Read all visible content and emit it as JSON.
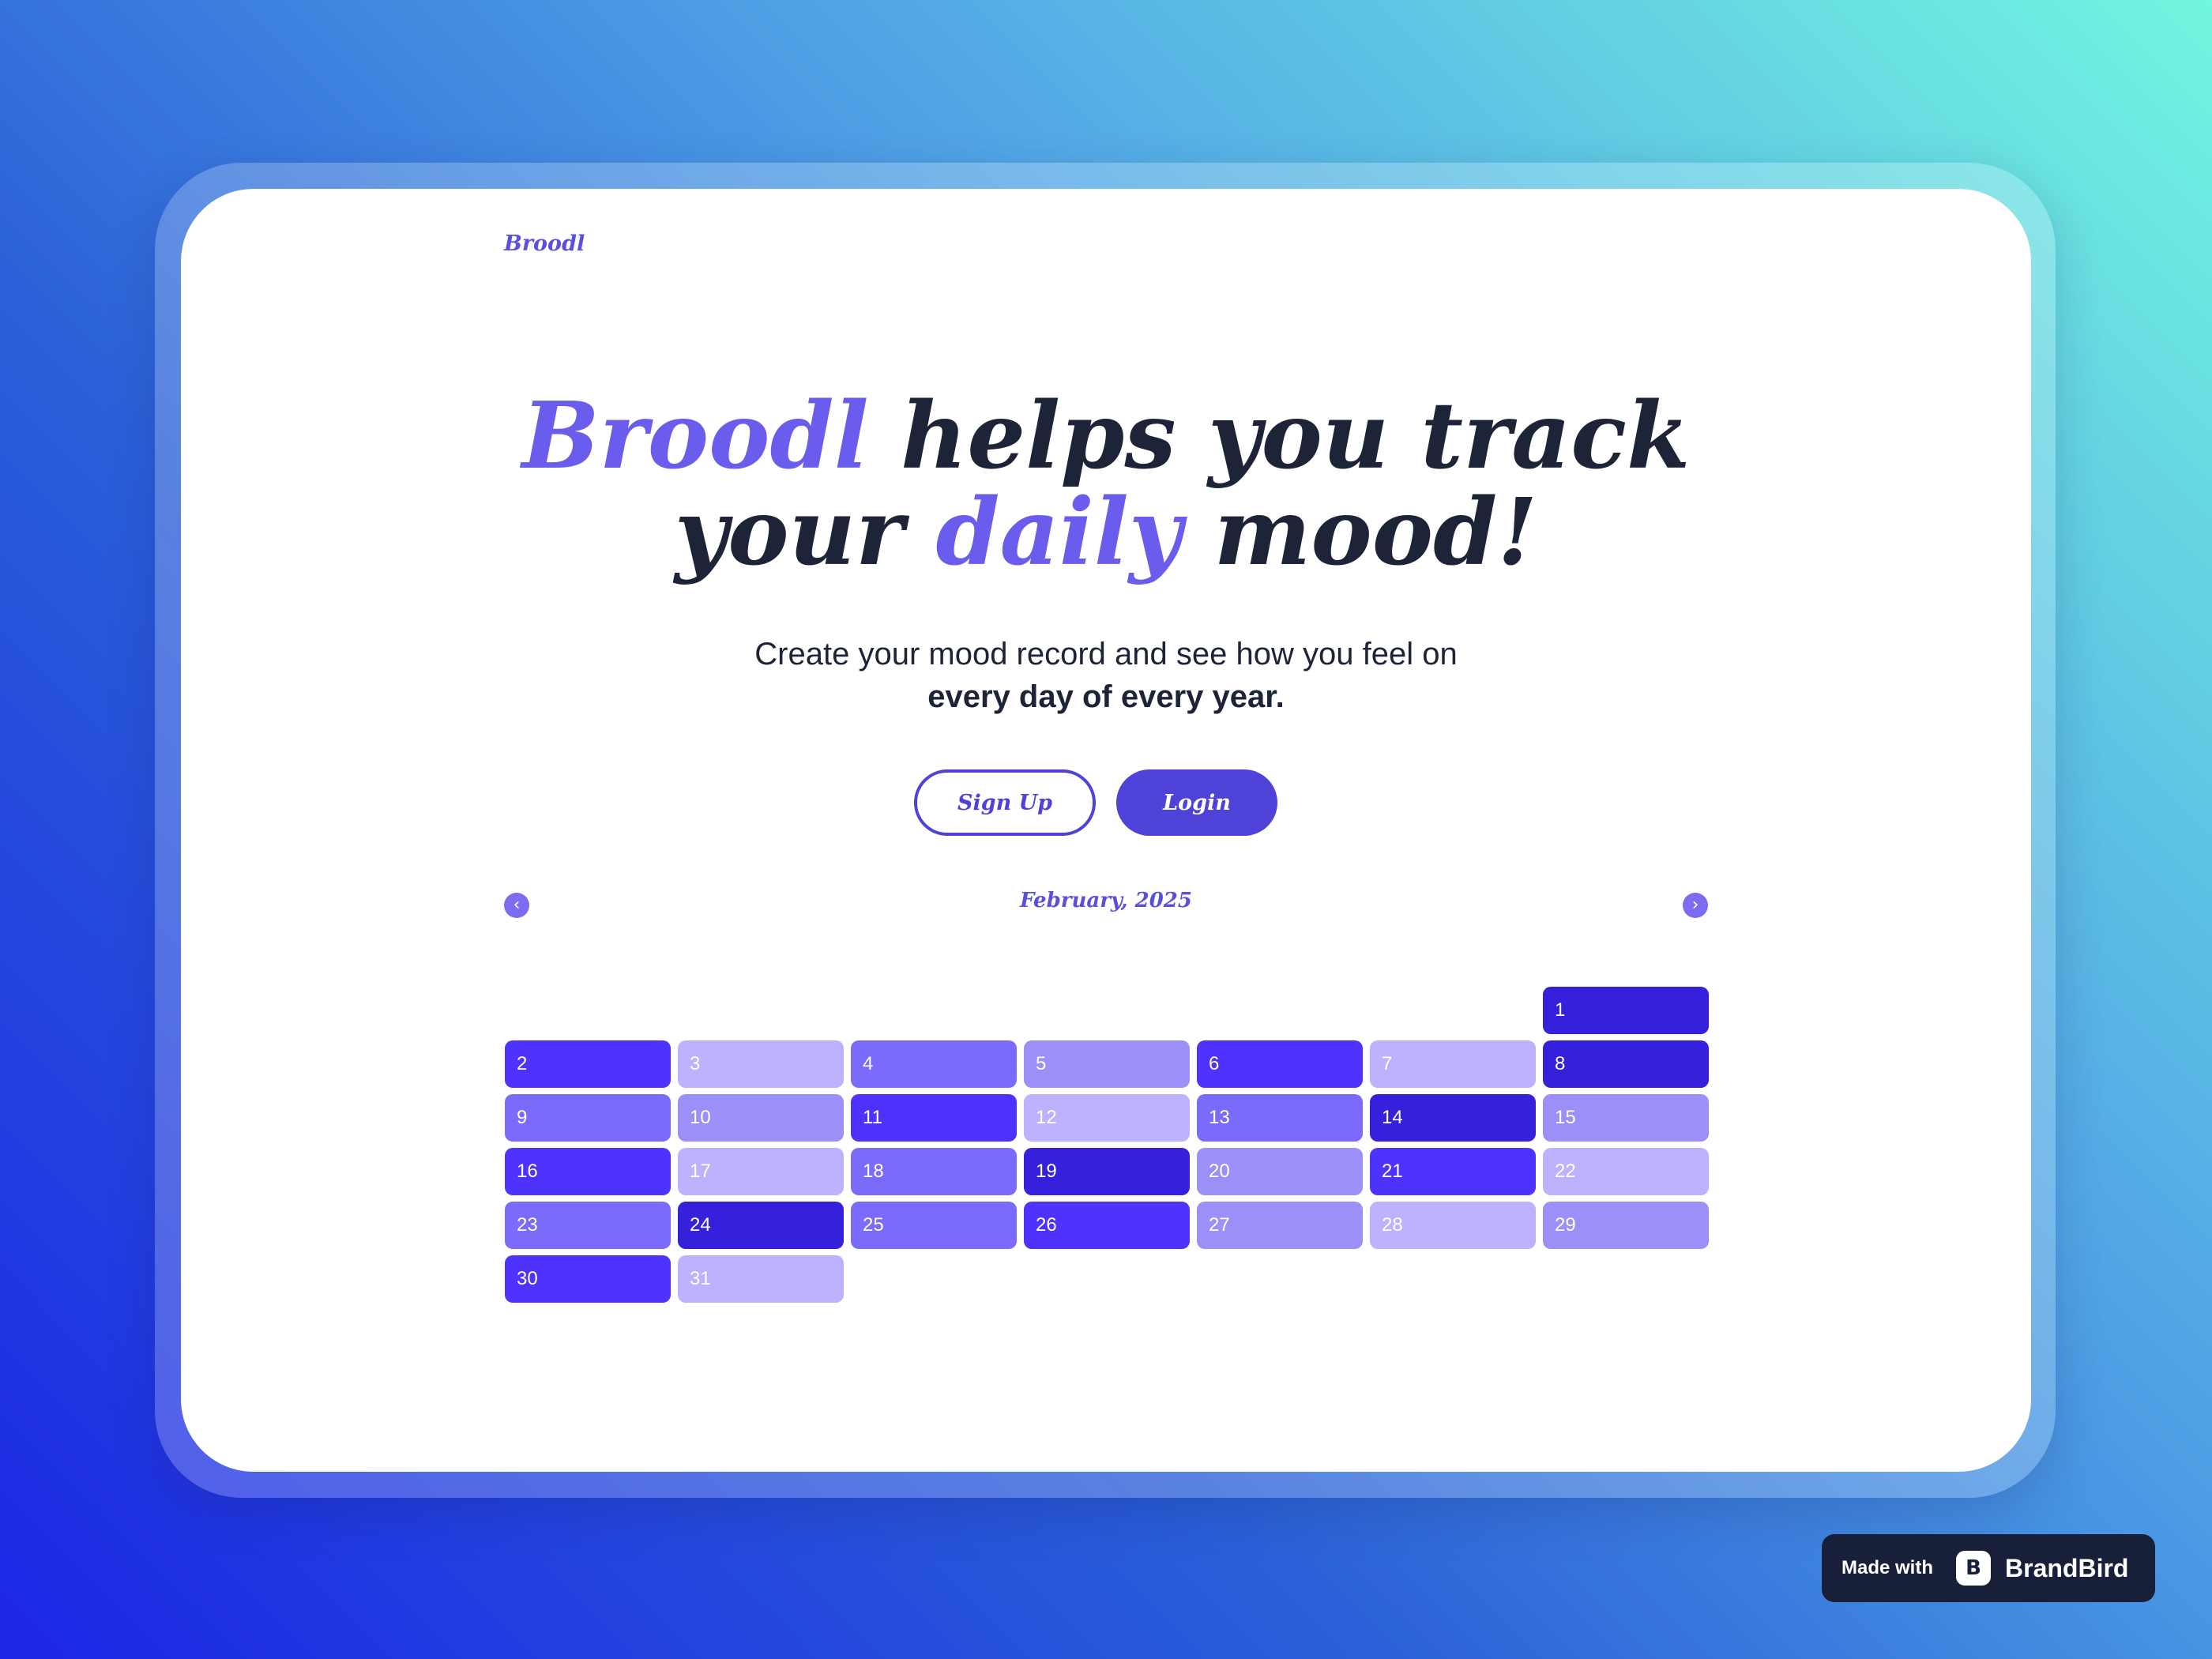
{
  "brand": {
    "name": "Broodl"
  },
  "hero": {
    "brand_word": "Broodl",
    "line1_rest": " helps you track",
    "line2_start": "your ",
    "accent_word": "daily",
    "line2_end": " mood!"
  },
  "subtitle": {
    "line1": "Create your mood record and see how you feel on",
    "line2": "every day of every year."
  },
  "buttons": {
    "signup": "Sign Up",
    "login": "Login"
  },
  "calendar": {
    "month": "February, 2025",
    "prev_icon": "chevron-left-icon",
    "next_icon": "chevron-right-icon",
    "prev_glyph": "‹",
    "next_glyph": "›",
    "first_weekday_index": 6,
    "mood_colors": {
      "1": "#bcb2fe",
      "2": "#9a90f8",
      "3": "#7b6bfa",
      "4": "#4d33fd",
      "5": "#3521dc"
    },
    "days": [
      {
        "label": "1",
        "mood": 5
      },
      {
        "label": "2",
        "mood": 4
      },
      {
        "label": "3",
        "mood": 1
      },
      {
        "label": "4",
        "mood": 3
      },
      {
        "label": "5",
        "mood": 2
      },
      {
        "label": "6",
        "mood": 4
      },
      {
        "label": "7",
        "mood": 1
      },
      {
        "label": "8",
        "mood": 5
      },
      {
        "label": "9",
        "mood": 3
      },
      {
        "label": "10",
        "mood": 2
      },
      {
        "label": "11",
        "mood": 4
      },
      {
        "label": "12",
        "mood": 1
      },
      {
        "label": "13",
        "mood": 3
      },
      {
        "label": "14",
        "mood": 5
      },
      {
        "label": "15",
        "mood": 2
      },
      {
        "label": "16",
        "mood": 4
      },
      {
        "label": "17",
        "mood": 1
      },
      {
        "label": "18",
        "mood": 3
      },
      {
        "label": "19",
        "mood": 5
      },
      {
        "label": "20",
        "mood": 2
      },
      {
        "label": "21",
        "mood": 4
      },
      {
        "label": "22",
        "mood": 1
      },
      {
        "label": "23",
        "mood": 3
      },
      {
        "label": "24",
        "mood": 5
      },
      {
        "label": "25",
        "mood": 3
      },
      {
        "label": "26",
        "mood": 4
      },
      {
        "label": "27",
        "mood": 2
      },
      {
        "label": "28",
        "mood": 1
      },
      {
        "label": "29",
        "mood": 2
      },
      {
        "label": "30",
        "mood": 4
      },
      {
        "label": "31",
        "mood": 1
      }
    ]
  },
  "badge": {
    "made_with": "Made with",
    "logo_icon": "brandbird-logo-icon",
    "logo_glyph": "B",
    "name": "BrandBird"
  }
}
